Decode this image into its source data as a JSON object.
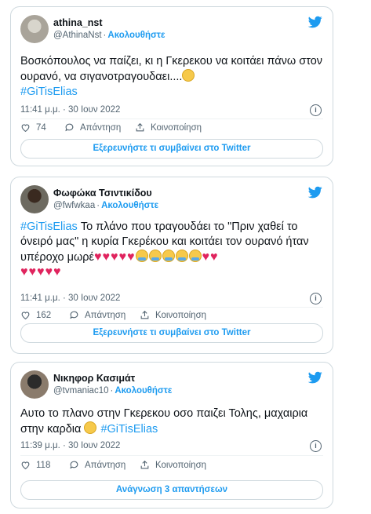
{
  "tweets": [
    {
      "name": "athina_nst",
      "handle": "@AthinaNst",
      "follow": "Ακολουθήστε",
      "text": "Βοσκόπουλος να παίζει, κι η Γκερεκου να κοιτάει πάνω στον ουρανό, να σιγανοτραγουδαει....",
      "hashtag": "#GiTisElias",
      "time": "11:41 μ.μ. · 30 Ιουν 2022",
      "likes": "74",
      "reply": "Απάντηση",
      "share": "Κοινοποίηση",
      "cta": "Εξερευνήστε τι συμβαίνει στο Twitter"
    },
    {
      "name": "Φωφώκα Τσιντικίδου",
      "handle": "@fwfwkaa",
      "follow": "Ακολουθήστε",
      "hashtag": "#GiTisElias",
      "text": " Το πλάνο που τραγουδάει το \"Πριν χαθεί το όνειρό μας\" η κυρία Γκερέκου και κοιτάει τον ουρανό ήταν υπέροχο μωρέ",
      "time": "11:41 μ.μ. · 30 Ιουν 2022",
      "likes": "162",
      "reply": "Απάντηση",
      "share": "Κοινοποίηση",
      "cta": "Εξερευνήστε τι συμβαίνει στο Twitter"
    },
    {
      "name": "Νικηφορ Κασιμάτ",
      "handle": "@tvmaniac10",
      "follow": "Ακολουθήστε",
      "text": "Αυτο το πλανο στην Γκερεκου οσο παιζει Τολης, μαχαιρια στην καρδια ",
      "hashtag": "#GiTisElias",
      "time": "11:39 μ.μ. · 30 Ιουν 2022",
      "likes": "118",
      "reply": "Απάντηση",
      "share": "Κοινοποίηση",
      "cta": "Ανάγνωση 3 απαντήσεων"
    }
  ],
  "icons": {
    "brand": "twitter-bird-icon",
    "like": "heart-icon",
    "reply": "reply-bubble-icon",
    "share": "share-icon",
    "info": "info-icon"
  },
  "colors": {
    "accent": "#1d9bf0",
    "muted": "#536471",
    "border": "#cfd9de",
    "heart": "#e0245e"
  }
}
